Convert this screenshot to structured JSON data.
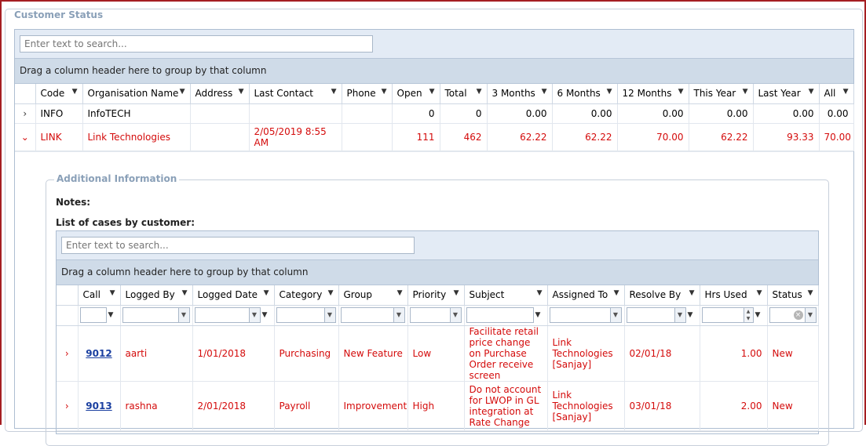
{
  "panel": {
    "title": "Customer Status"
  },
  "main_grid": {
    "search_placeholder": "Enter text to search...",
    "group_hint": "Drag a column header here to group by that column",
    "columns": [
      "Code",
      "Organisation Name",
      "Address",
      "Last Contact",
      "Phone",
      "Open",
      "Total",
      "3 Months",
      "6 Months",
      "12 Months",
      "This Year",
      "Last Year",
      "All"
    ],
    "rows": [
      {
        "code": "INFO",
        "org": "InfoTECH",
        "address": "",
        "last_contact": "",
        "phone": "",
        "open": "0",
        "total": "0",
        "m3": "0.00",
        "m6": "0.00",
        "m12": "0.00",
        "this_year": "0.00",
        "last_year": "0.00",
        "all": "0.00"
      },
      {
        "code": "LINK",
        "org": "Link Technologies",
        "address": "",
        "last_contact": "2/05/2019 8:55 AM",
        "phone": "",
        "open": "111",
        "total": "462",
        "m3": "62.22",
        "m6": "62.22",
        "m12": "70.00",
        "this_year": "62.22",
        "last_year": "93.33",
        "all": "70.00"
      }
    ]
  },
  "detail": {
    "title": "Additional Information",
    "notes_label": "Notes:",
    "cases_label": "List of cases by customer:",
    "search_placeholder": "Enter text to search...",
    "group_hint": "Drag a column header here to group by that column",
    "columns": [
      "Call",
      "Logged By",
      "Logged Date",
      "Category",
      "Group",
      "Priority",
      "Subject",
      "Assigned To",
      "Resolve By",
      "Hrs Used",
      "Status"
    ],
    "rows": [
      {
        "call": "9012",
        "logged_by": "aarti",
        "logged_date": "1/01/2018",
        "category": "Purchasing",
        "group": "New Feature",
        "priority": "Low",
        "subject": "Facilitate retail price change on Purchase Order receive screen",
        "assigned_to": "Link Technologies [Sanjay]",
        "resolve_by": "02/01/18",
        "hrs_used": "1.00",
        "status": "New"
      },
      {
        "call": "9013",
        "logged_by": "rashna",
        "logged_date": "2/01/2018",
        "category": "Payroll",
        "group": "Improvement",
        "priority": "High",
        "subject": "Do not account for LWOP in GL integration at Rate Change",
        "assigned_to": "Link Technologies [Sanjay]",
        "resolve_by": "03/01/18",
        "hrs_used": "2.00",
        "status": "New"
      }
    ]
  },
  "colors": {
    "accent_red": "#d40b0b",
    "header_bg": "#e3ebf5",
    "group_bg": "#cfdbe8",
    "legend": "#8aa0b8",
    "link": "#1a3fa0"
  },
  "icons": {
    "filter": "funnel-icon",
    "expand": "chevron-right-icon",
    "collapse": "chevron-down-icon",
    "dropdown": "dropdown-arrow-icon",
    "clear": "clear-x-icon"
  }
}
